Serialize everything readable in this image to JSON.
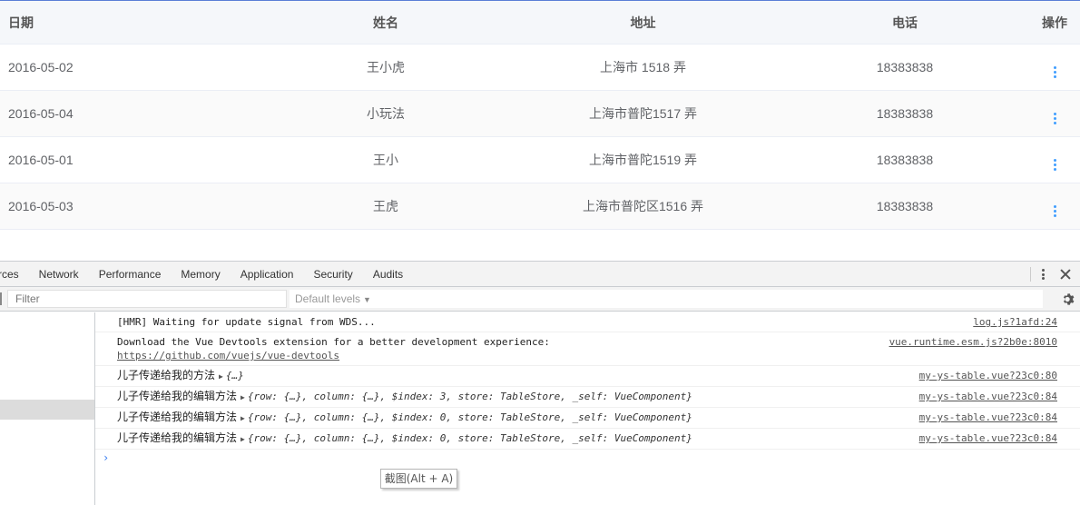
{
  "table": {
    "headers": {
      "date": "日期",
      "name": "姓名",
      "address": "地址",
      "phone": "电话",
      "ops": "操作"
    },
    "rows": [
      {
        "date": "2016-05-02",
        "name": "王小虎",
        "address": "上海市 1518 弄",
        "phone": "18383838"
      },
      {
        "date": "2016-05-04",
        "name": "小玩法",
        "address": "上海市普陀1517 弄",
        "phone": "18383838"
      },
      {
        "date": "2016-05-01",
        "name": "王小",
        "address": "上海市普陀1519 弄",
        "phone": "18383838"
      },
      {
        "date": "2016-05-03",
        "name": "王虎",
        "address": "上海市普陀区1516 弄",
        "phone": "18383838"
      }
    ],
    "row_action_icon": "more-vertical-icon",
    "accent_color": "#409eff"
  },
  "devtools": {
    "tabs": [
      "rces",
      "Network",
      "Performance",
      "Memory",
      "Application",
      "Security",
      "Audits"
    ],
    "filter": {
      "placeholder": "Filter",
      "value": ""
    },
    "levels": "Default levels",
    "messages": {
      "m0": {
        "text": "[HMR] Waiting for update signal from WDS...",
        "source": "log.js?1afd:24"
      },
      "m1": {
        "text": "Download the Vue Devtools extension for a better development experience:",
        "link": "https://github.com/vuejs/vue-devtools",
        "source": "vue.runtime.esm.js?2b0e:8010"
      },
      "m2": {
        "text": "儿子传递给我的方法",
        "obj": "{…}",
        "source": "my-ys-table.vue?23c0:80"
      },
      "m3": {
        "text": "儿子传递给我的编辑方法",
        "obj": "{row: {…}, column: {…}, $index: 3, store: TableStore, _self: VueComponent}",
        "source": "my-ys-table.vue?23c0:84"
      },
      "m4": {
        "text": "儿子传递给我的编辑方法",
        "obj": "{row: {…}, column: {…}, $index: 0, store: TableStore, _self: VueComponent}",
        "source": "my-ys-table.vue?23c0:84"
      },
      "m5": {
        "text": "儿子传递给我的编辑方法",
        "obj": "{row: {…}, column: {…}, $index: 0, store: TableStore, _self: VueComponent}",
        "source": "my-ys-table.vue?23c0:84"
      }
    },
    "prompt": "›"
  },
  "tooltip": "截图(Alt + A)"
}
